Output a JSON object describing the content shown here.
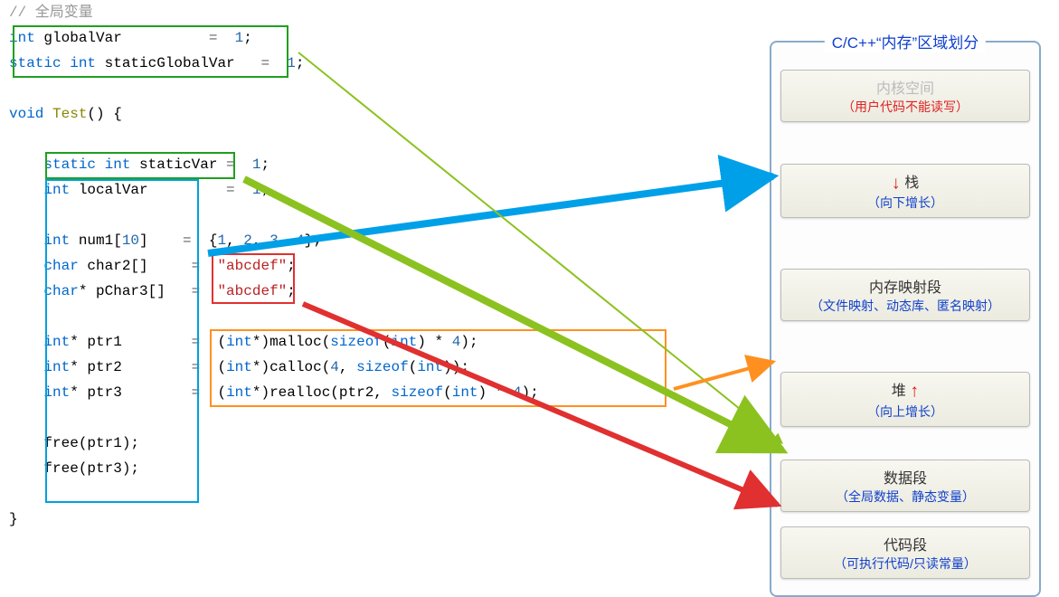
{
  "comment_global": "// 全局变量",
  "code": {
    "l1a": "int",
    "l1b": " globalVar          ",
    "l1c": "=",
    "l1d": "  1",
    "l1e": ";",
    "l2a": "static int",
    "l2b": " staticGlobalVar   ",
    "l2c": "=",
    "l2d": "  1",
    "l2e": ";",
    "l3a": "void",
    "l3b": " Test",
    "l3c": "() {",
    "l4a": "static int",
    "l4b": " staticVar ",
    "l4c": "=",
    "l4d": "  1",
    "l4e": ";",
    "l5a": "int",
    "l5b": " localVar         ",
    "l5c": "=",
    "l5d": "  1",
    "l5e": ";",
    "l6a": "int",
    "l6b": " num1[",
    "l6c": "10",
    "l6d": "]    ",
    "l6e": "=",
    "l6f": "  {",
    "l6g": "1",
    "l6h": ", ",
    "l6i": "2",
    "l6j": ", ",
    "l6k": "3",
    "l6l": ", ",
    "l6m": "4",
    "l6n": "};",
    "l7a": "char",
    "l7b": " char2[]     ",
    "l7c": "=",
    "l7d": "  \"abcdef\"",
    "l7e": ";",
    "l8a": "char",
    "l8b": "* pChar3[]   ",
    "l8c": "=",
    "l8d": "  \"abcdef\"",
    "l8e": ";",
    "l9a": "int",
    "l9b": "* ptr1        ",
    "l9c": "=",
    "l9d": "  (",
    "l9e": "int",
    "l9f": "*)malloc(",
    "l9g": "sizeof",
    "l9h": "(",
    "l9i": "int",
    "l9j": ") * ",
    "l9k": "4",
    "l9l": ");",
    "l10a": "int",
    "l10b": "* ptr2        ",
    "l10c": "=",
    "l10d": "  (",
    "l10e": "int",
    "l10f": "*)calloc(",
    "l10g": "4",
    "l10h": ", ",
    "l10i": "sizeof",
    "l10j": "(",
    "l10k": "int",
    "l10l": "));",
    "l11a": "int",
    "l11b": "* ptr3        ",
    "l11c": "=",
    "l11d": "  (",
    "l11e": "int",
    "l11f": "*)realloc(ptr2, ",
    "l11g": "sizeof",
    "l11h": "(",
    "l11i": "int",
    "l11j": ") * ",
    "l11k": "4",
    "l11l": ");",
    "l12": "free(ptr1);",
    "l13": "free(ptr3);",
    "l14": "}"
  },
  "mem": {
    "title": "C/C++“内存”区域划分",
    "kernel": {
      "label": "内核空间",
      "sub": "（用户代码不能读写）"
    },
    "stack": {
      "label": "栈",
      "sub": "（向下增长）",
      "arrow": "↓"
    },
    "mmap": {
      "label": "内存映射段",
      "sub": "（文件映射、动态库、匿名映射）"
    },
    "heap": {
      "label": "堆",
      "sub": "（向上增长）",
      "arrow": "↑"
    },
    "data": {
      "label": "数据段",
      "sub": "（全局数据、静态变量）"
    },
    "text": {
      "label": "代码段",
      "sub": "（可执行代码/只读常量）"
    }
  }
}
